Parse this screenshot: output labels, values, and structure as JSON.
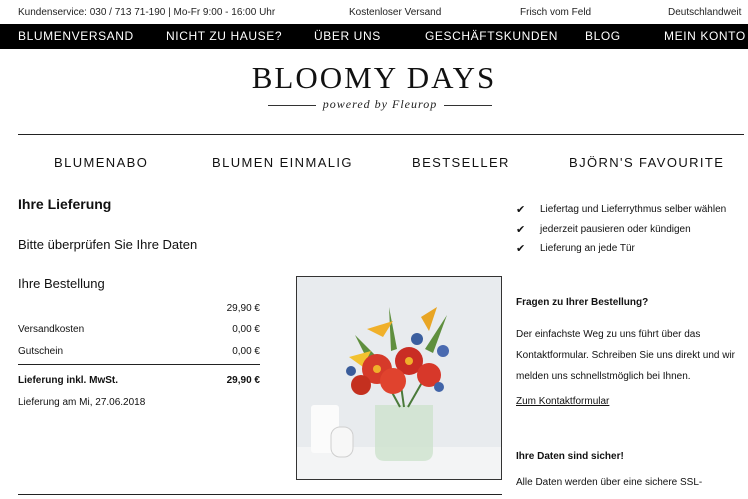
{
  "topbar": {
    "service": "Kundenservice: 030 / 713 71-190 | Mo-Fr 9:00 - 16:00 Uhr",
    "shipping": "Kostenloser Versand",
    "fresh": "Frisch vom Feld",
    "region": "Deutschlandweit"
  },
  "mainnav": {
    "items": [
      "BLUMENVERSAND",
      "NICHT ZU HAUSE?",
      "ÜBER UNS",
      "GESCHÄFTSKUNDEN",
      "BLOG",
      "MEIN KONTO"
    ]
  },
  "logo": {
    "title": "BLOOMY DAYS",
    "tagline": "powered by Fleurop"
  },
  "catnav": {
    "items": [
      "BLUMENABO",
      "BLUMEN EINMALIG",
      "BESTSELLER",
      "BJÖRN'S FAVOURITE"
    ]
  },
  "delivery": {
    "heading": "Ihre Lieferung",
    "check": "Bitte überprüfen Sie Ihre Daten",
    "order_heading": "Ihre Bestellung",
    "rows": [
      {
        "label": "",
        "value": "29,90 €"
      },
      {
        "label": "Versandkosten",
        "value": "0,00 €"
      },
      {
        "label": "Gutschein",
        "value": "0,00 €"
      },
      {
        "label": "Lieferung inkl. MwSt.",
        "value": "29,90 €"
      }
    ],
    "date": "Lieferung am Mi, 27.06.2018"
  },
  "benefits": [
    "Liefertag und Lieferrythmus selber wählen",
    "jederzeit pausieren oder kündigen",
    "Lieferung an jede Tür"
  ],
  "help": {
    "heading": "Fragen zu Ihrer Bestellung?",
    "text": "Der einfachste Weg zu uns führt über das Kontaktformular. Schreiben Sie uns direkt und wir melden uns schnellstmöglich bei Ihnen.",
    "link": "Zum Kontaktformular"
  },
  "security": {
    "heading": "Ihre Daten sind sicher!",
    "text": "Alle Daten werden über eine sichere SSL-"
  },
  "icons": {
    "check": "check-icon",
    "product_image": "flower-bouquet-image"
  },
  "colors": {
    "nav_bg": "#000000",
    "nav_text": "#ffffff",
    "text": "#111111"
  }
}
